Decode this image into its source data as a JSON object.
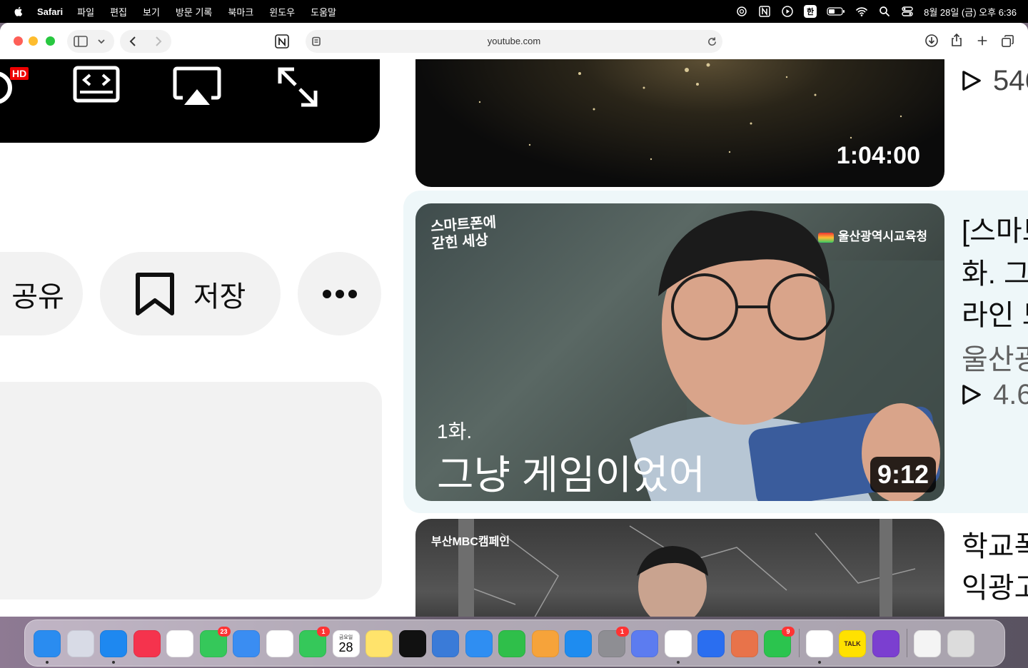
{
  "menubar": {
    "app": "Safari",
    "items": [
      "파일",
      "편집",
      "보기",
      "방문 기록",
      "북마크",
      "윈도우",
      "도움말"
    ],
    "input_method": "한",
    "clock": "8월 28일 (금) 오후 6:36"
  },
  "browser": {
    "url": "youtube.com"
  },
  "player": {
    "hd_badge": "HD"
  },
  "actions": {
    "share_label": "공유",
    "save_label": "저장"
  },
  "videos": [
    {
      "duration": "1:04:00",
      "side_views": "546"
    },
    {
      "duration": "9:12",
      "thumb_topleft_line1": "스마트폰에",
      "thumb_topleft_line2": "갇힌 세상",
      "thumb_channel": "울산광역시교육청",
      "thumb_episode": "1화.",
      "thumb_caption": "그냥 게임이었어",
      "title_line1": "[스마트",
      "title_line2": "화. 그",
      "title_line3": "라인 드",
      "channel": "울산광",
      "views": "4.6"
    },
    {
      "thumb_brand": "부산MBC캠페인",
      "title_line1": "학교폭",
      "title_line2": "익광고"
    }
  ],
  "dock": {
    "apps": [
      {
        "name": "Finder",
        "color": "#2a8cf0",
        "running": true
      },
      {
        "name": "Launchpad",
        "color": "#d8dbe6"
      },
      {
        "name": "Safari",
        "color": "#1e88f0",
        "running": true
      },
      {
        "name": "Music",
        "color": "#f5334d"
      },
      {
        "name": "Chrome",
        "color": "#ffffff"
      },
      {
        "name": "Messages",
        "color": "#35c85a",
        "badge": "23"
      },
      {
        "name": "Mail",
        "color": "#3a8df2"
      },
      {
        "name": "Photos",
        "color": "#ffffff"
      },
      {
        "name": "FaceTime",
        "color": "#35c85a",
        "badge": "1"
      },
      {
        "name": "Calendar",
        "color": "#ffffff",
        "day_label": "금요일",
        "day": "28"
      },
      {
        "name": "Notes",
        "color": "#ffe36b"
      },
      {
        "name": "Perplexity",
        "color": "#111111"
      },
      {
        "name": "Keynote2",
        "color": "#3a7bd8"
      },
      {
        "name": "Keynote",
        "color": "#2f8ef2"
      },
      {
        "name": "Numbers",
        "color": "#2fbf4a"
      },
      {
        "name": "Pages",
        "color": "#f6a33a"
      },
      {
        "name": "App Store",
        "color": "#1e8cf0"
      },
      {
        "name": "System Settings",
        "color": "#8e8e93",
        "badge": "1"
      },
      {
        "name": "Simulator",
        "color": "#5c7cf0"
      },
      {
        "name": "ChatGPT",
        "color": "#ffffff",
        "running": true
      },
      {
        "name": "Copilot",
        "color": "#2a6ef0"
      },
      {
        "name": "Claude",
        "color": "#e8734a"
      },
      {
        "name": "Naver",
        "color": "#2bc44e",
        "badge": "9"
      },
      {
        "name": "Notion",
        "color": "#ffffff",
        "running": true
      },
      {
        "name": "KakaoTalk",
        "color": "#ffe100",
        "label": "TALK"
      },
      {
        "name": "OneNote",
        "color": "#7b3fd0"
      },
      {
        "name": "Documents",
        "color": "#f4f4f4"
      },
      {
        "name": "Trash",
        "color": "#dcdcdc"
      }
    ]
  }
}
